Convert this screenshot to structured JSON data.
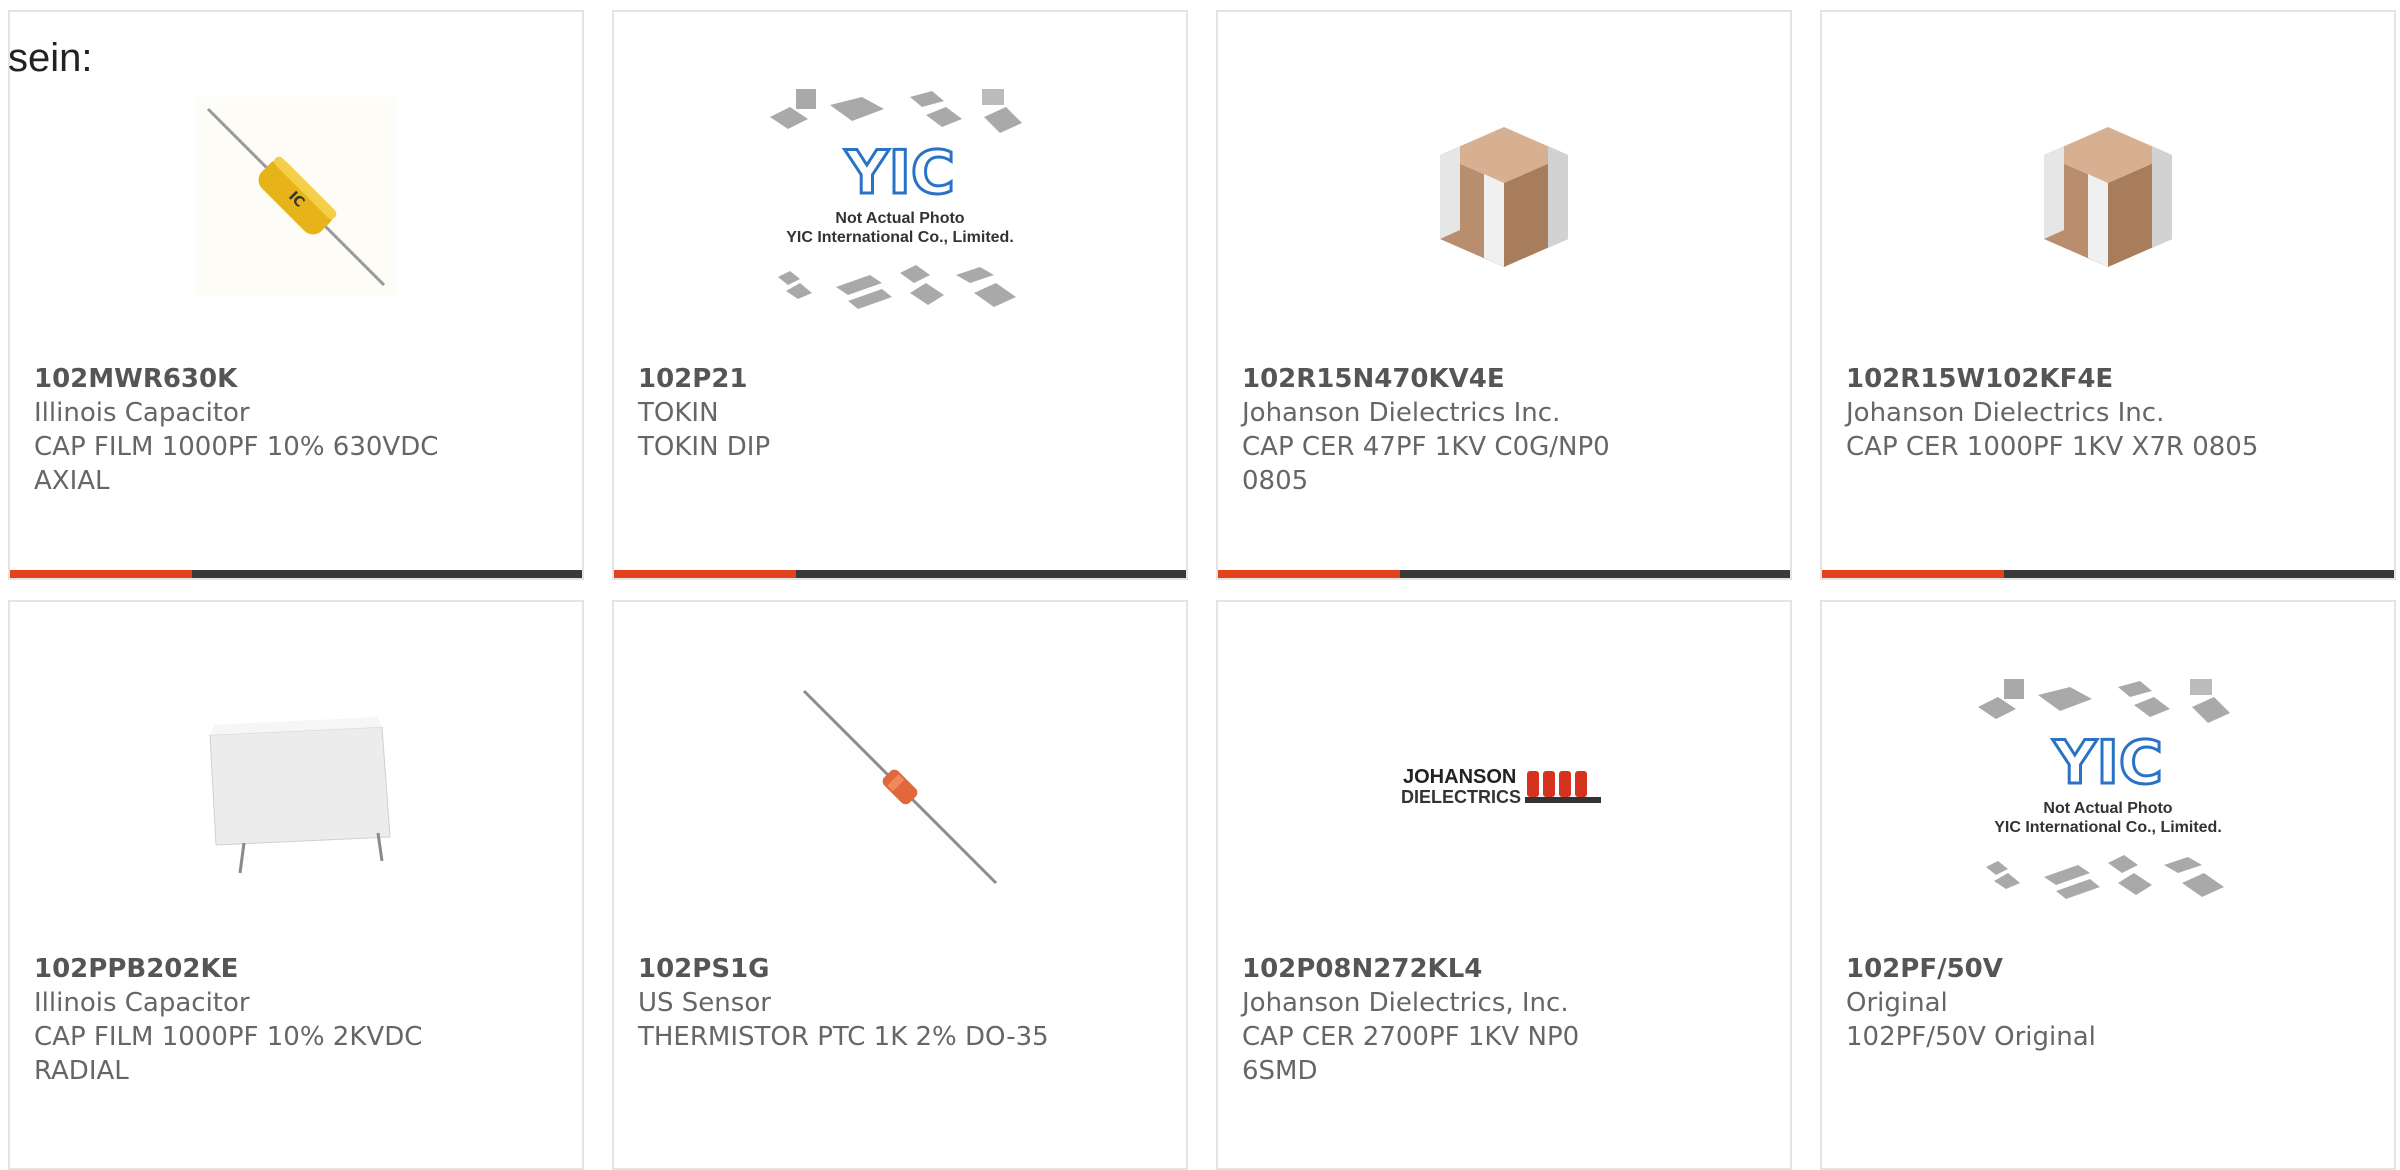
{
  "lead_text": "sein:",
  "accent_color": "#e3431c",
  "bar_color": "#3a3a3a",
  "products": [
    {
      "part": "102MWR630K",
      "manufacturer": "Illinois Capacitor",
      "description": "CAP FILM 1000PF 10% 630VDC AXIAL",
      "image": "axial-film-capacitor"
    },
    {
      "part": "102P21",
      "manufacturer": "TOKIN",
      "description": "TOKIN DIP",
      "image": "yic-placeholder",
      "image_caption_1": "Not Actual Photo",
      "image_caption_2": "YIC International Co., Limited.",
      "image_logo": "YIC"
    },
    {
      "part": "102R15N470KV4E",
      "manufacturer": "Johanson Dielectrics Inc.",
      "description": "CAP CER 47PF 1KV C0G/NP0 0805",
      "image": "smd-ceramic-chip"
    },
    {
      "part": "102R15W102KF4E",
      "manufacturer": "Johanson Dielectrics Inc.",
      "description": "CAP CER 1000PF 1KV X7R 0805",
      "image": "smd-ceramic-chip"
    },
    {
      "part": "102PPB202KE",
      "manufacturer": "Illinois Capacitor",
      "description": "CAP FILM 1000PF 10% 2KVDC RADIAL",
      "image": "box-film-capacitor"
    },
    {
      "part": "102PS1G",
      "manufacturer": "US Sensor",
      "description": "THERMISTOR PTC 1K 2% DO-35",
      "image": "axial-thermistor"
    },
    {
      "part": "102P08N272KL4",
      "manufacturer": "Johanson Dielectrics, Inc.",
      "description": "CAP CER 2700PF 1KV NP0 6SMD",
      "image": "johanson-logo",
      "image_logo_1": "JOHANSON",
      "image_logo_2": "DIELECTRICS"
    },
    {
      "part": "102PF/50V",
      "manufacturer": "Original",
      "description": "102PF/50V Original",
      "image": "yic-placeholder",
      "image_caption_1": "Not Actual Photo",
      "image_caption_2": "YIC International Co., Limited.",
      "image_logo": "YIC"
    }
  ]
}
